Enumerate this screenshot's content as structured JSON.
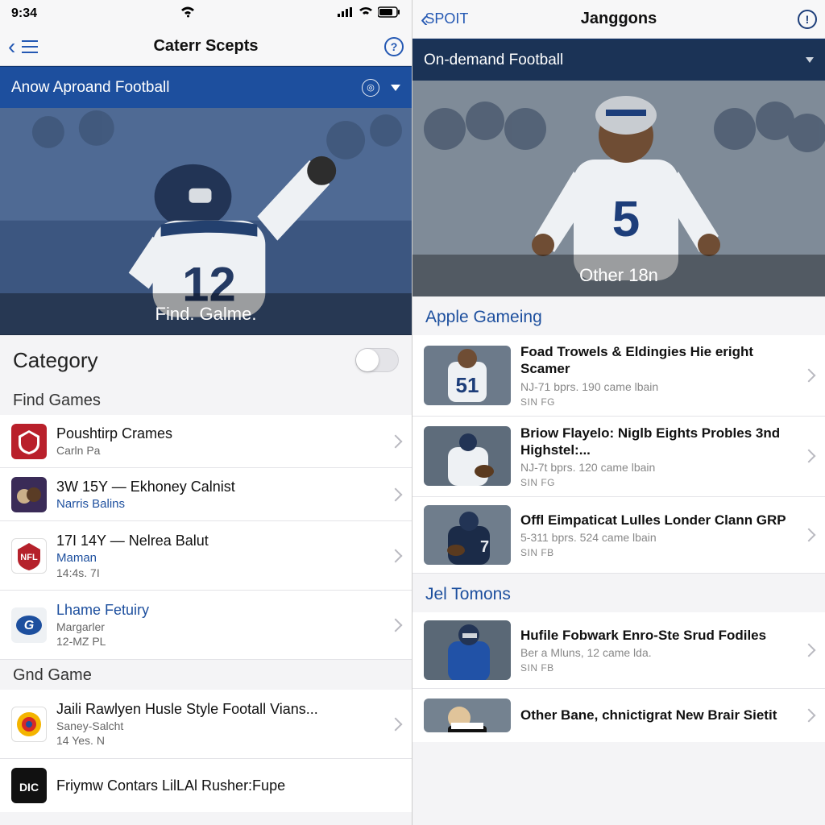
{
  "left": {
    "status": {
      "time": "9:34"
    },
    "nav": {
      "title": "Caterr Scepts"
    },
    "bluebar": {
      "label": "Anow Aproand Football"
    },
    "hero_caption": "Find. Galme.",
    "category_label": "Category",
    "section_find": "Find Games",
    "section_gnd": "Gnd Game",
    "rows": [
      {
        "title": "Poushtirp Crames",
        "sub": "Carln Pa"
      },
      {
        "title": "3W 15Y — Ekhoney Calnist",
        "sub": "Narris Balins"
      },
      {
        "title": "17I 14Y — Nelrea Balut",
        "sub": "Maman",
        "meta": "14:4s. 7I"
      },
      {
        "title": "Lhame Fetuiry",
        "sub": "Margarler",
        "meta": "12-MZ PL"
      }
    ],
    "rows2": [
      {
        "title": "Jaili Rawlyen Husle Style Footall Vians...",
        "sub": "Saney-Salcht",
        "meta": "14 Yes. N"
      },
      {
        "title": "Friymw Contars LilLAl Rusher:Fupe"
      }
    ]
  },
  "right": {
    "nav": {
      "back": "SPOIT",
      "title": "Janggons"
    },
    "bluebar": {
      "label": "On-demand Football"
    },
    "hero_caption": "Other 18n",
    "section_apple": "Apple Gameing",
    "section_jel": "Jel Tomons",
    "cards": [
      {
        "t1": "Foad Trowels & Eldingies Hie eright Scamer",
        "t2": "NJ-71 bprs. 190 came lbain",
        "tag": "SIN FG"
      },
      {
        "t1": "Briow Flayelo: Niglb Eights Probles 3nd Highstel:...",
        "t2": "NJ-7t bprs. 120 came lbain",
        "tag": "SIN FG"
      },
      {
        "t1": "Offl Eimpaticat Lulles Londer Clann GRP",
        "t2": "5-311 bprs. 524 came lbain",
        "tag": "SIN FB"
      }
    ],
    "cards2": [
      {
        "t1": "Hufile Fobwark Enro-Ste Srud Fodiles",
        "t2": "Ber a Mluns, 12 came lda.",
        "tag": "SIN FB"
      },
      {
        "t1": "Other Bane, chnictigrat New Brair Sietit"
      }
    ]
  }
}
